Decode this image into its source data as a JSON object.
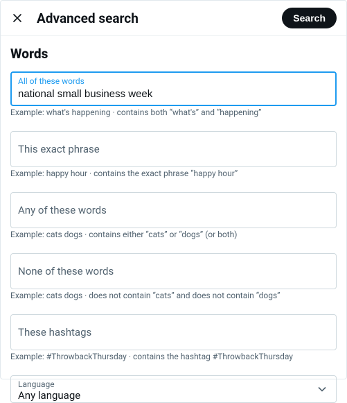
{
  "header": {
    "title": "Advanced search",
    "search_button": "Search"
  },
  "section": {
    "words_title": "Words"
  },
  "fields": {
    "all_words": {
      "label": "All of these words",
      "value": "national small business week",
      "example": "Example: what's happening · contains both “what's” and “happening”"
    },
    "exact_phrase": {
      "placeholder": "This exact phrase",
      "example": "Example: happy hour · contains the exact phrase “happy hour”"
    },
    "any_words": {
      "placeholder": "Any of these words",
      "example": "Example: cats dogs · contains either “cats” or “dogs” (or both)"
    },
    "none_words": {
      "placeholder": "None of these words",
      "example": "Example: cats dogs · does not contain “cats” and does not contain “dogs”"
    },
    "hashtags": {
      "placeholder": "These hashtags",
      "example": "Example: #ThrowbackThursday · contains the hashtag #ThrowbackThursday"
    },
    "language": {
      "label": "Language",
      "value": "Any language"
    }
  }
}
